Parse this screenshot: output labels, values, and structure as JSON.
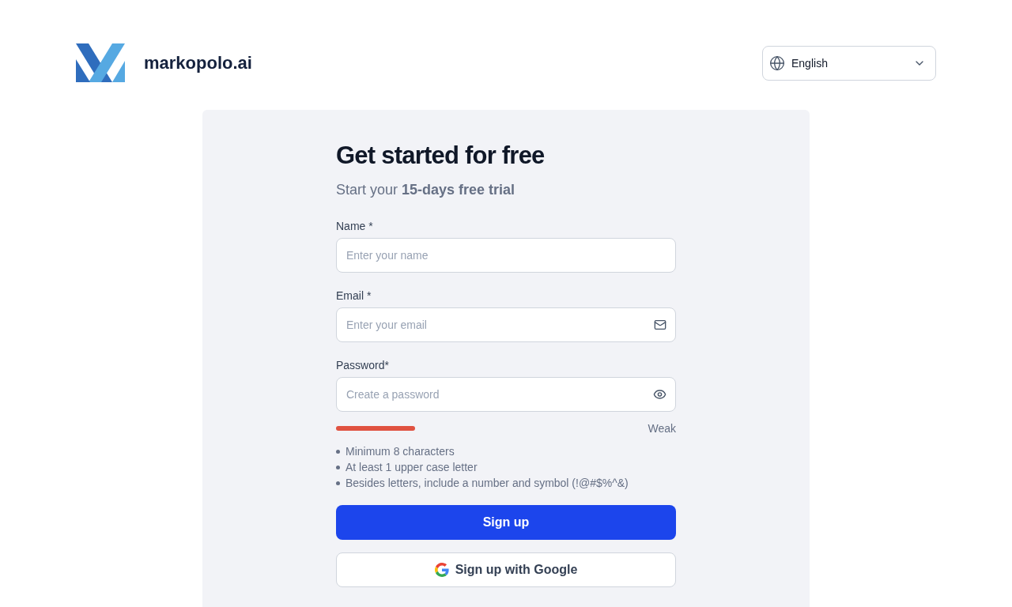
{
  "header": {
    "logo_text": "markopolo.ai",
    "language_select": {
      "value": "English"
    }
  },
  "form": {
    "title": "Get started for free",
    "subtitle": "Start your **15-days free trial**",
    "fields": [
      {
        "kind": "text",
        "label": "Name *",
        "placeholder": "Enter your name"
      },
      {
        "kind": "email",
        "label": "Email *",
        "placeholder": "Enter your email"
      },
      {
        "kind": "password",
        "label": "Password*",
        "placeholder": "Create a password"
      }
    ],
    "password_strength": {
      "level": 0.265,
      "reading": "Weak"
    },
    "requirements": [
      "Minimum 8 characters",
      "At least 1 upper case letter",
      "Besides letters, include a number and symbol (!@#$%^&)"
    ],
    "buttons": [
      {
        "kind": "primary",
        "label": "Sign up"
      },
      {
        "kind": "google",
        "label": "Sign up with Google"
      }
    ]
  }
}
